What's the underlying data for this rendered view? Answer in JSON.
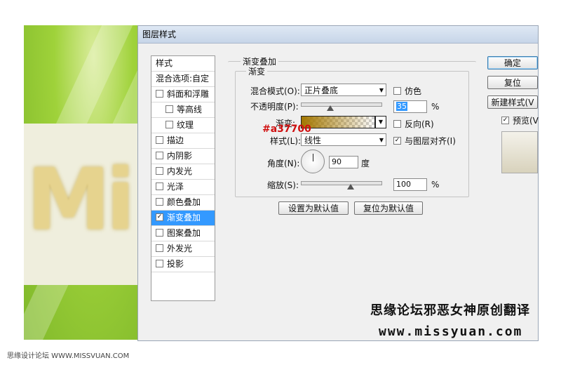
{
  "window": {
    "title": "图层样式"
  },
  "styles_panel": {
    "items": [
      {
        "label": "样式",
        "kind": "header",
        "checked": false
      },
      {
        "label": "混合选项:自定",
        "kind": "header",
        "checked": false
      },
      {
        "label": "斜面和浮雕",
        "kind": "check",
        "checked": false
      },
      {
        "label": "等高线",
        "kind": "sub",
        "checked": false
      },
      {
        "label": "纹理",
        "kind": "sub",
        "checked": false
      },
      {
        "label": "描边",
        "kind": "check",
        "checked": false
      },
      {
        "label": "内阴影",
        "kind": "check",
        "checked": false
      },
      {
        "label": "内发光",
        "kind": "check",
        "checked": false
      },
      {
        "label": "光泽",
        "kind": "check",
        "checked": false
      },
      {
        "label": "颜色叠加",
        "kind": "check",
        "checked": false
      },
      {
        "label": "渐变叠加",
        "kind": "check",
        "checked": true,
        "selected": true
      },
      {
        "label": "图案叠加",
        "kind": "check",
        "checked": false
      },
      {
        "label": "外发光",
        "kind": "check",
        "checked": false
      },
      {
        "label": "投影",
        "kind": "check",
        "checked": false
      }
    ]
  },
  "gradient_overlay": {
    "group_title": "渐变叠加",
    "sub_group_title": "渐变",
    "blend_mode_label": "混合模式(O):",
    "blend_mode_value": "正片叠底",
    "dither_label": "仿色",
    "dither_checked": false,
    "opacity_label": "不透明度(P):",
    "opacity_value": "35",
    "opacity_unit": "%",
    "gradient_label": "渐变:",
    "reverse_label": "反向(R)",
    "reverse_checked": false,
    "style_label": "样式(L):",
    "style_value": "线性",
    "align_label": "与图层对齐(I)",
    "align_checked": true,
    "angle_label": "角度(N):",
    "angle_value": "90",
    "angle_unit": "度",
    "scale_label": "缩放(S):",
    "scale_value": "100",
    "scale_unit": "%",
    "make_default_label": "设置为默认值",
    "reset_default_label": "复位为默认值",
    "gradient_color": "#a37700"
  },
  "annotation": {
    "text": "#a37700",
    "color": "#d01010"
  },
  "right_buttons": {
    "ok_label": "确定",
    "reset_label": "复位",
    "new_style_label": "新建样式(V",
    "preview_label": "预览(V",
    "preview_checked": true
  },
  "watermark": {
    "line1": "思缘论坛邪恶女神原创翻译",
    "line2": "www.missyuan.com"
  },
  "footer": {
    "credit": "思缘设计论坛 WWW.MISSVUAN.COM"
  }
}
